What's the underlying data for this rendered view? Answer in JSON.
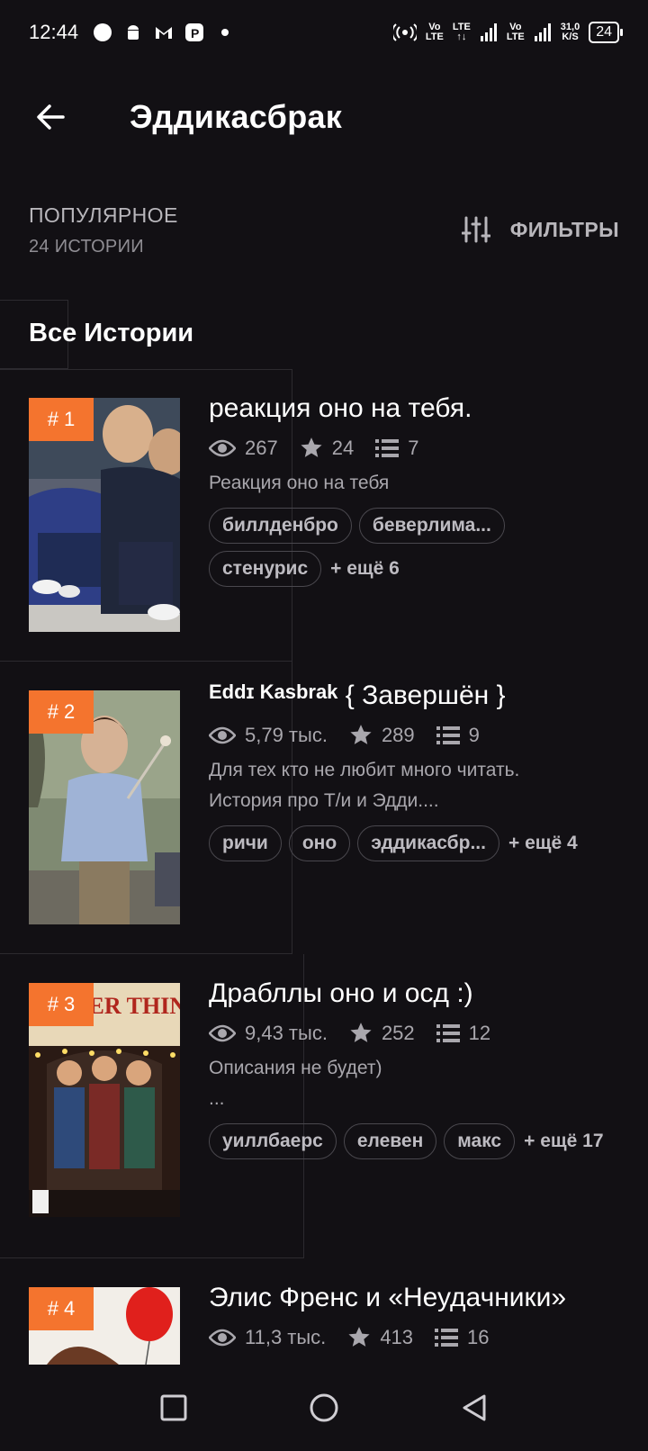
{
  "status_bar": {
    "time": "12:44",
    "net_top_1": "Vo",
    "net_bot_1": "LTE",
    "net_top_2": "LTE",
    "net_bot_2": "↑↓",
    "net_top_3": "Vo",
    "net_bot_3": "LTE",
    "speed_top": "31,0",
    "speed_bot": "K/S",
    "battery": "24"
  },
  "header": {
    "title": "Эддикасбрак"
  },
  "sort": {
    "label": "ПОПУЛЯРНОЕ",
    "count": "24 ИСТОРИИ"
  },
  "filter": {
    "label": "ФИЛЬТРЫ"
  },
  "section": {
    "title": "Все Истории"
  },
  "stories": [
    {
      "rank": "# 1",
      "title": "реакция оно на тебя.",
      "title_prefix": "",
      "views": "267",
      "stars": "24",
      "parts": "7",
      "desc_line1": "Реакция оно на тебя",
      "desc_line2": "",
      "tags": [
        "биллденбро",
        "беверлима...",
        "стенурис"
      ],
      "more": "+ ещё 6"
    },
    {
      "rank": "# 2",
      "title_prefix": "Eddɪ Kasbrak",
      "title": "{ Завершён }",
      "views": "5,79 тыс.",
      "stars": "289",
      "parts": "9",
      "desc_line1": "Для тех кто не любит много читать.",
      "desc_line2": "История про Т/и и Эдди....",
      "tags": [
        "ричи",
        "оно",
        "эддикасбр..."
      ],
      "more": "+ ещё 4"
    },
    {
      "rank": "# 3",
      "title": "Драбллы оно и осд :)",
      "title_prefix": "",
      "views": "9,43 тыс.",
      "stars": "252",
      "parts": "12",
      "desc_line1": "Описания не будет)",
      "desc_line2": "...",
      "tags": [
        "уиллбаерс",
        "елевен",
        "макс"
      ],
      "more": "+ ещё 17",
      "cover_text": "STRANGER THINGS"
    },
    {
      "rank": "# 4",
      "title": "Элис Френс и «Неудачники»",
      "title_prefix": "",
      "views": "11,3 тыс.",
      "stars": "413",
      "parts": "16"
    }
  ],
  "colors": {
    "background": "#121014",
    "accent": "#f4742e",
    "muted": "#a9a7ad"
  },
  "icons": {
    "back": "arrow-left-icon",
    "filter": "sliders-icon",
    "views": "eye-icon",
    "stars": "star-icon",
    "parts": "list-icon",
    "nav": [
      "square-icon",
      "circle-icon",
      "triangle-back-icon"
    ]
  }
}
